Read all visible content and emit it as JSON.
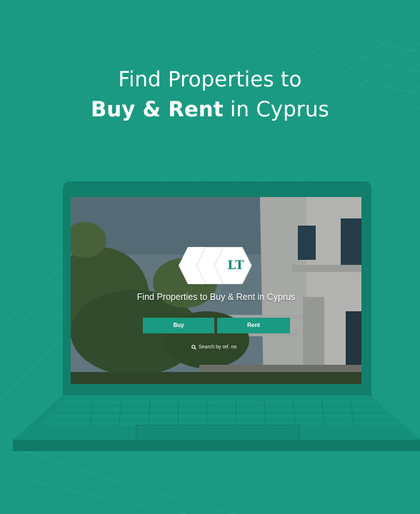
{
  "headline": {
    "line1": "Find Properties to",
    "bold": "Buy & Rent",
    "rest": " in Cyprus"
  },
  "screen": {
    "logo_text": "LT",
    "tagline": "Find Properties to Buy & Rent in Cyprus",
    "buy_label": "Buy",
    "rent_label": "Rent",
    "search_ref": "Search by ref. no"
  },
  "colors": {
    "background": "#1a9a82",
    "laptop": "#117f6b",
    "button": "#1a9a82",
    "text": "#ffffff"
  },
  "icons": [
    "logo-hexagon-icon",
    "search-icon"
  ]
}
